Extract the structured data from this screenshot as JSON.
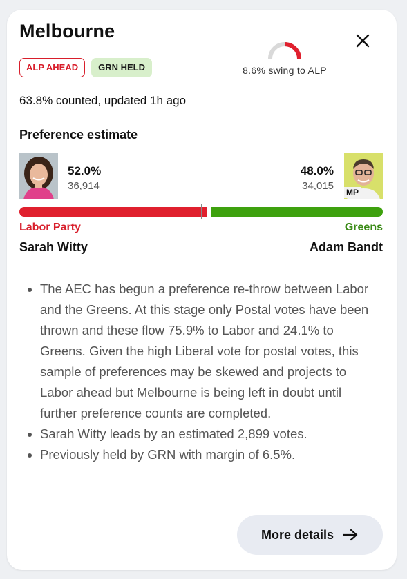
{
  "seat": {
    "title": "Melbourne",
    "badges": [
      {
        "label": "ALP AHEAD",
        "color": "#d81e2b"
      },
      {
        "label": "GRN HELD",
        "color": "#d8efcb"
      }
    ],
    "swing_text": "8.6% swing to ALP",
    "swing_fraction": 0.5,
    "counted_text": "63.8% counted, updated 1h ago"
  },
  "preference": {
    "title": "Preference estimate",
    "left": {
      "percent": "52.0%",
      "votes": "36,914",
      "party": "Labor Party",
      "candidate": "Sarah Witty",
      "share": 52.0,
      "color": "#e0202e"
    },
    "right": {
      "percent": "48.0%",
      "votes": "34,015",
      "party": "Greens",
      "candidate": "Adam Bandt",
      "share": 48.0,
      "mp_tag": "MP",
      "color": "#3ea10e"
    }
  },
  "notes": [
    "The AEC has begun a preference re-throw between Labor and the Greens. At this stage only Postal votes have been thrown and these flow 75.9% to Labor and 24.1% to Greens. Given the high Liberal vote for postal votes, this sample of preferences may be skewed and projects to Labor ahead but Melbourne is being left in doubt until further preference counts are completed.",
    "Sarah Witty leads by an estimated 2,899 votes.",
    "Previously held by GRN with margin of 6.5%."
  ],
  "actions": {
    "more_details": "More details"
  },
  "icons": {
    "close": "close-icon",
    "arrow": "arrow-right-icon",
    "gauge": "swing-gauge-icon"
  }
}
